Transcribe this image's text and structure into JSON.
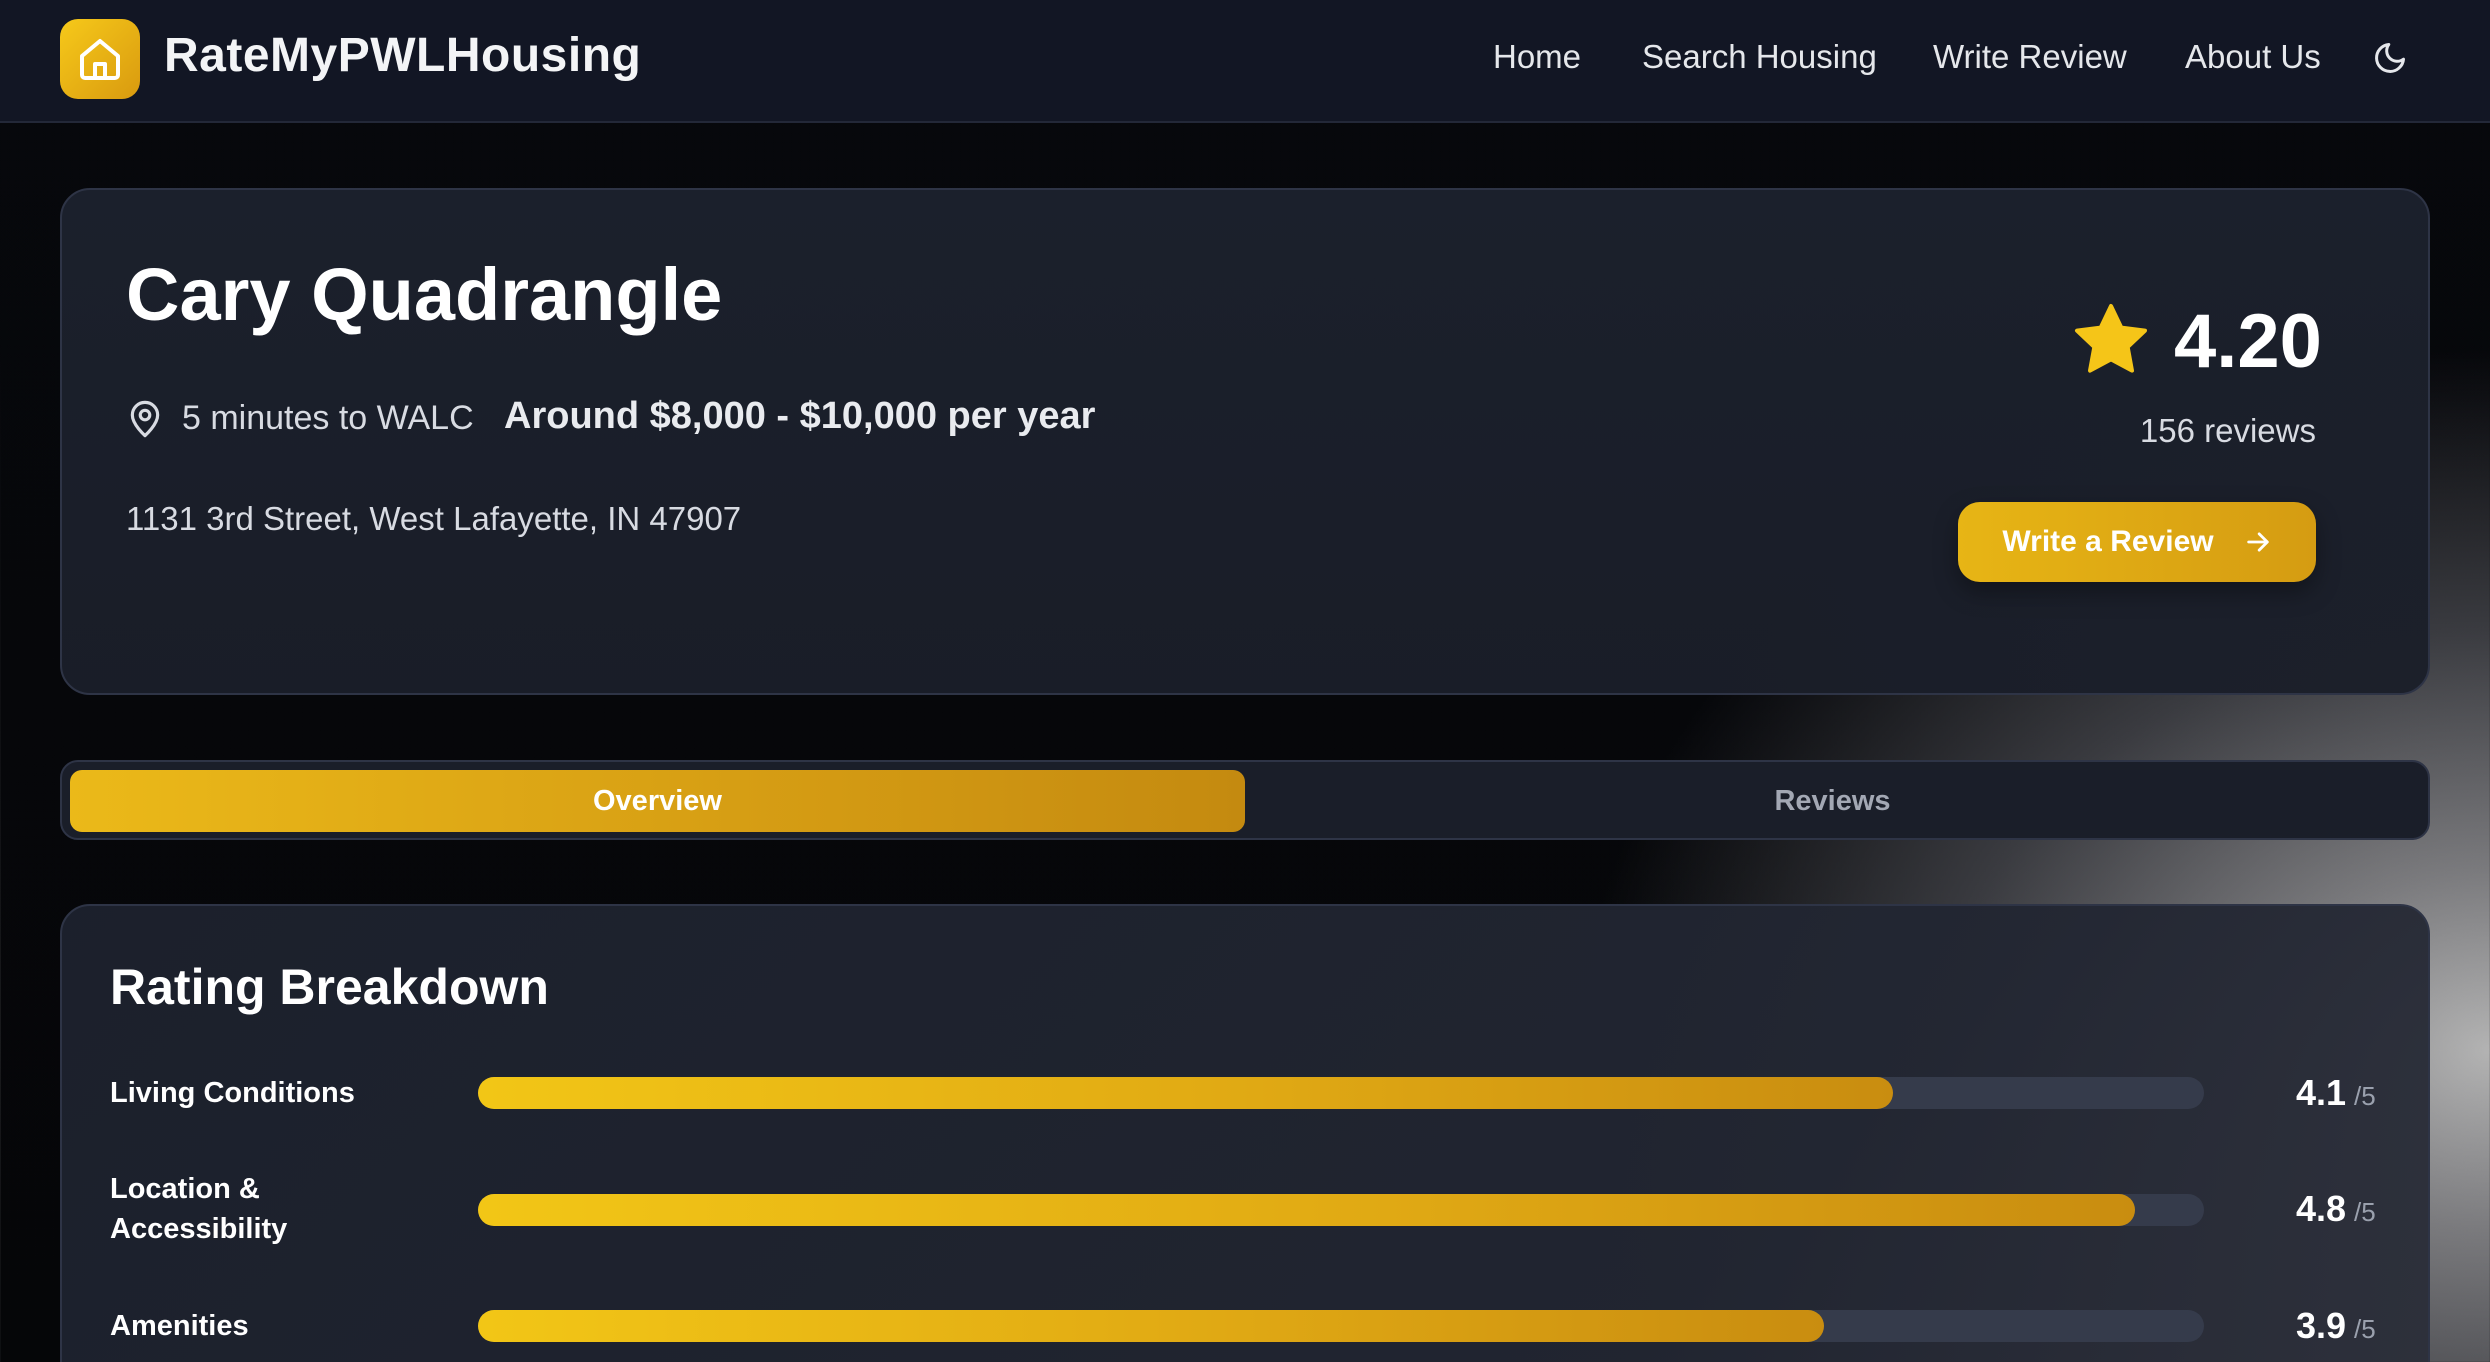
{
  "navbar": {
    "brand": "RateMyPWLHousing",
    "links": [
      "Home",
      "Search Housing",
      "Write Review",
      "About Us"
    ]
  },
  "property": {
    "name": "Cary Quadrangle",
    "distance": "5 minutes to WALC",
    "price": "Around $8,000 - $10,000 per year",
    "address": "1131 3rd Street, West Lafayette, IN 47907",
    "rating": "4.20",
    "reviews": "156 reviews",
    "write_review_label": "Write a Review"
  },
  "tabs": {
    "overview": "Overview",
    "reviews": "Reviews",
    "active": "Overview"
  },
  "breakdown": {
    "title": "Rating Breakdown",
    "max_label": "/5",
    "items": [
      {
        "label": "Living Conditions",
        "score": "4.1",
        "fill_fraction": 0.82
      },
      {
        "label": "Location & Accessibility",
        "score": "4.8",
        "fill_fraction": 0.96
      },
      {
        "label": "Amenities",
        "score": "3.9",
        "fill_fraction": 0.78
      }
    ]
  },
  "colors": {
    "accent": "#e7b515",
    "navbar_bg": "#121624",
    "card_bg": "#1c212d",
    "bar_track": "#353b4b"
  },
  "icons": {
    "logo": "home-icon",
    "theme": "moon-icon",
    "location": "map-pin-icon",
    "rating": "star-icon",
    "button": "arrow-right-icon"
  }
}
